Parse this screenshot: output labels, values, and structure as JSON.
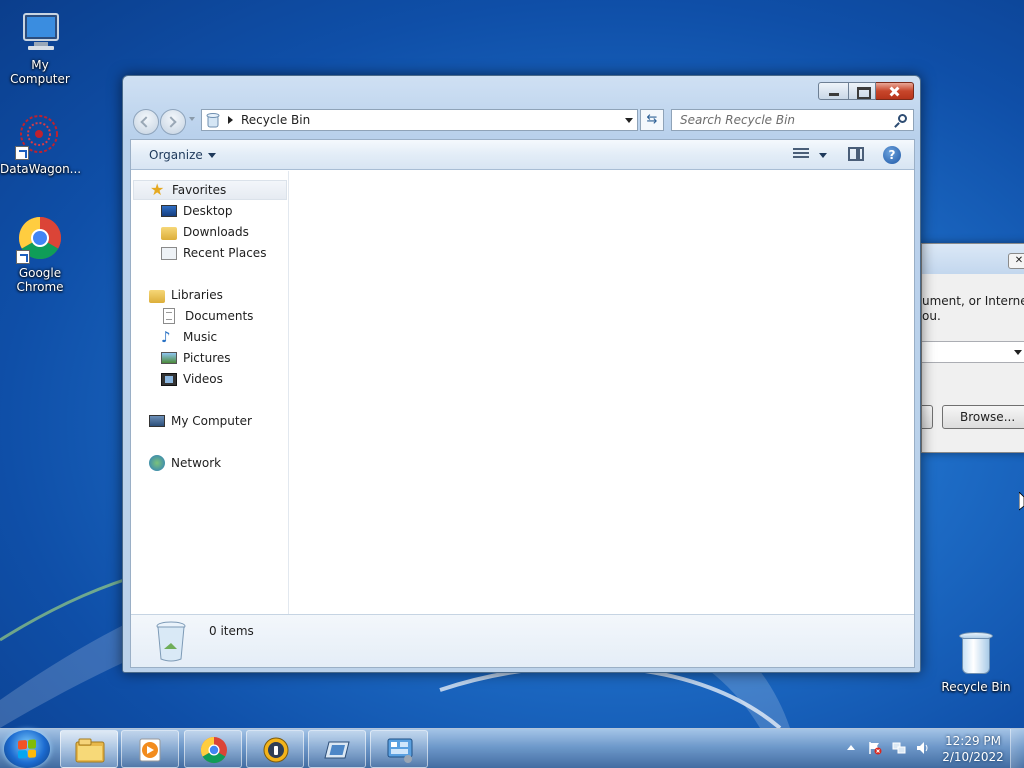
{
  "desktop": {
    "icons": [
      {
        "label": "My Computer",
        "icon": "computer-icon"
      },
      {
        "label": "DataWagon...",
        "icon": "datawagon-icon"
      },
      {
        "label": "Google Chrome",
        "icon": "chrome-icon"
      },
      {
        "label": "Recycle Bin",
        "icon": "recycle-bin-icon"
      }
    ]
  },
  "background_dialog": {
    "text_line1": "ument, or Internet",
    "text_line2": "ou.",
    "browse_label": "Browse..."
  },
  "explorer": {
    "address_location": "Recycle Bin",
    "search_placeholder": "Search Recycle Bin",
    "organize_label": "Organize",
    "help_glyph": "?",
    "nav": {
      "favorites": "Favorites",
      "desktop": "Desktop",
      "downloads": "Downloads",
      "recent_places": "Recent Places",
      "libraries": "Libraries",
      "documents": "Documents",
      "music": "Music",
      "pictures": "Pictures",
      "videos": "Videos",
      "my_computer": "My Computer",
      "network": "Network"
    },
    "details": {
      "item_count": "0 items"
    }
  },
  "taskbar": {
    "clock_time": "12:29 PM",
    "clock_date": "2/10/2022",
    "pinned": [
      {
        "icon": "file-explorer-icon",
        "active": true
      },
      {
        "icon": "media-player-icon",
        "active": false
      },
      {
        "icon": "chrome-icon",
        "active": false
      },
      {
        "icon": "security-app-icon",
        "active": false
      },
      {
        "icon": "remote-desktop-icon",
        "active": false
      },
      {
        "icon": "control-panel-icon",
        "active": false
      }
    ]
  },
  "colors": {
    "desktop_blue": "#1f6fc9",
    "close_red": "#c7462b",
    "link_text": "#1e395b"
  }
}
